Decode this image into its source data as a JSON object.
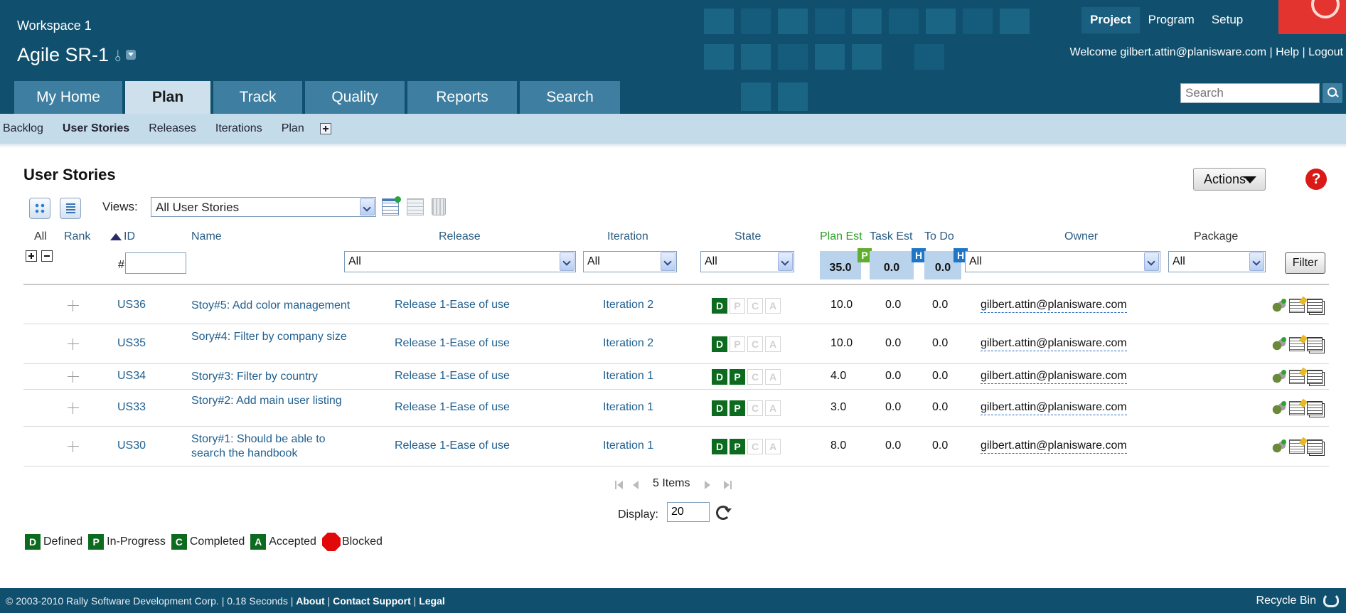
{
  "header": {
    "workspace": "Workspace 1",
    "project": "Agile SR-1",
    "top_nav": [
      {
        "label": "Project",
        "active": true
      },
      {
        "label": "Program",
        "active": false
      },
      {
        "label": "Setup",
        "active": false
      }
    ],
    "welcome_prefix": "Welcome ",
    "user": "gilbert.attin@planisware.com",
    "help": "Help",
    "logout": "Logout",
    "search_placeholder": "Search",
    "brand_color": "#10506e"
  },
  "main_nav": [
    {
      "label": "My Home",
      "active": false
    },
    {
      "label": "Plan",
      "active": true
    },
    {
      "label": "Track",
      "active": false
    },
    {
      "label": "Quality",
      "active": false
    },
    {
      "label": "Reports",
      "active": false
    },
    {
      "label": "Search",
      "active": false
    }
  ],
  "sub_nav": [
    {
      "label": "Backlog",
      "active": false
    },
    {
      "label": "User Stories",
      "active": true
    },
    {
      "label": "Releases",
      "active": false
    },
    {
      "label": "Iterations",
      "active": false
    },
    {
      "label": "Plan",
      "active": false
    }
  ],
  "page": {
    "title": "User Stories",
    "actions_label": "Actions",
    "help_glyph": "?",
    "views_label": "Views:",
    "views_value": "All User Stories"
  },
  "columns": {
    "all": "All",
    "rank": "Rank",
    "id": "ID",
    "name": "Name",
    "release": "Release",
    "iteration": "Iteration",
    "state": "State",
    "plan_est": "Plan Est",
    "task_est": "Task Est",
    "to_do": "To Do",
    "owner": "Owner",
    "package": "Package"
  },
  "filters": {
    "id_hash": "#",
    "release": "All",
    "iteration": "All",
    "state": "All",
    "owner": "All",
    "package": "All",
    "filter_button": "Filter"
  },
  "totals": {
    "plan_est": "35.0",
    "plan_badge": "P",
    "task_est": "0.0",
    "task_badge": "H",
    "to_do": "0.0",
    "todo_badge": "H"
  },
  "stories": [
    {
      "id": "US36",
      "name": "Stoy#5: Add color management",
      "release": "Release 1-Ease of use",
      "iteration": "Iteration 2",
      "state": [
        "D"
      ],
      "plan_est": "10.0",
      "task_est": "0.0",
      "to_do": "0.0",
      "owner": "gilbert.attin@planisware.com"
    },
    {
      "id": "US35",
      "name": "Sory#4: Filter by company size",
      "release": "Release 1-Ease of use",
      "iteration": "Iteration 2",
      "state": [
        "D"
      ],
      "plan_est": "10.0",
      "task_est": "0.0",
      "to_do": "0.0",
      "owner": "gilbert.attin@planisware.com"
    },
    {
      "id": "US34",
      "name": "Story#3: Filter by country",
      "release": "Release 1-Ease of use",
      "iteration": "Iteration 1",
      "state": [
        "D",
        "P"
      ],
      "plan_est": "4.0",
      "task_est": "0.0",
      "to_do": "0.0",
      "owner": "gilbert.attin@planisware.com"
    },
    {
      "id": "US33",
      "name": "Story#2: Add main user listing",
      "release": "Release 1-Ease of use",
      "iteration": "Iteration 1",
      "state": [
        "D",
        "P"
      ],
      "plan_est": "3.0",
      "task_est": "0.0",
      "to_do": "0.0",
      "owner": "gilbert.attin@planisware.com"
    },
    {
      "id": "US30",
      "name": "Story#1: Should be able to search the handbook",
      "release": "Release 1-Ease of use",
      "iteration": "Iteration 1",
      "state": [
        "D",
        "P"
      ],
      "plan_est": "8.0",
      "task_est": "0.0",
      "to_do": "0.0",
      "owner": "gilbert.attin@planisware.com"
    }
  ],
  "state_letters": [
    "D",
    "P",
    "C",
    "A"
  ],
  "state_on_color": "#0d6b20",
  "pager": {
    "items": "5 Items",
    "display_label": "Display:",
    "display_value": "20"
  },
  "legend": [
    {
      "key": "D",
      "label": "Defined"
    },
    {
      "key": "P",
      "label": "In-Progress"
    },
    {
      "key": "C",
      "label": "Completed"
    },
    {
      "key": "A",
      "label": "Accepted"
    },
    {
      "key": "",
      "label": "Blocked"
    }
  ],
  "footer": {
    "copyright": "© 2003-2010 Rally Software Development Corp. | 0.18 Seconds | ",
    "about": "About",
    "contact": "Contact Support",
    "legal": "Legal",
    "recycle_bin": "Recycle Bin"
  }
}
